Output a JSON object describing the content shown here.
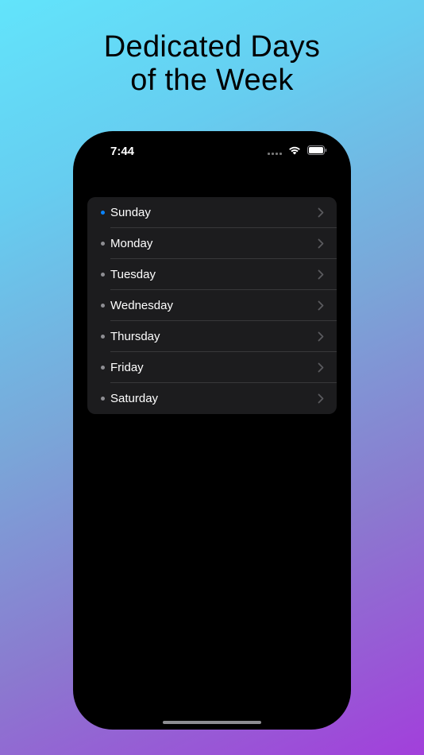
{
  "headline": {
    "line1": "Dedicated Days",
    "line2": "of the Week"
  },
  "status_bar": {
    "time": "7:44"
  },
  "colors": {
    "selected_dot": "#0a84ff",
    "dot": "#8e8e93",
    "card": "#1c1c1e"
  },
  "days": [
    {
      "label": "Sunday",
      "selected": true
    },
    {
      "label": "Monday",
      "selected": false
    },
    {
      "label": "Tuesday",
      "selected": false
    },
    {
      "label": "Wednesday",
      "selected": false
    },
    {
      "label": "Thursday",
      "selected": false
    },
    {
      "label": "Friday",
      "selected": false
    },
    {
      "label": "Saturday",
      "selected": false
    }
  ]
}
